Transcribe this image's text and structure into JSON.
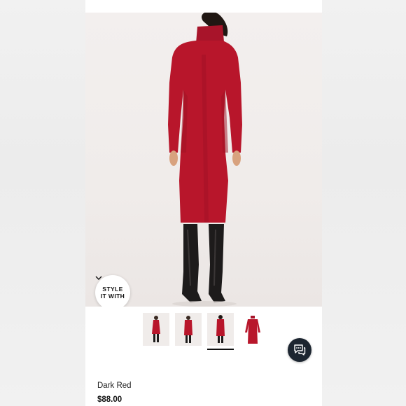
{
  "style_button": {
    "line1": "STYLE",
    "line2": "IT WITH",
    "icon": "chevron-down-icon"
  },
  "thumbnails": {
    "count": 4,
    "selected_index": 2
  },
  "chat_button": {
    "icon": "chat-bubbles-icon"
  },
  "product": {
    "color": "Dark Red",
    "price": "$88.00"
  },
  "colors": {
    "dress": "#b8162b",
    "boots": "#1d1b1b",
    "chat_bg": "#1c2530"
  }
}
